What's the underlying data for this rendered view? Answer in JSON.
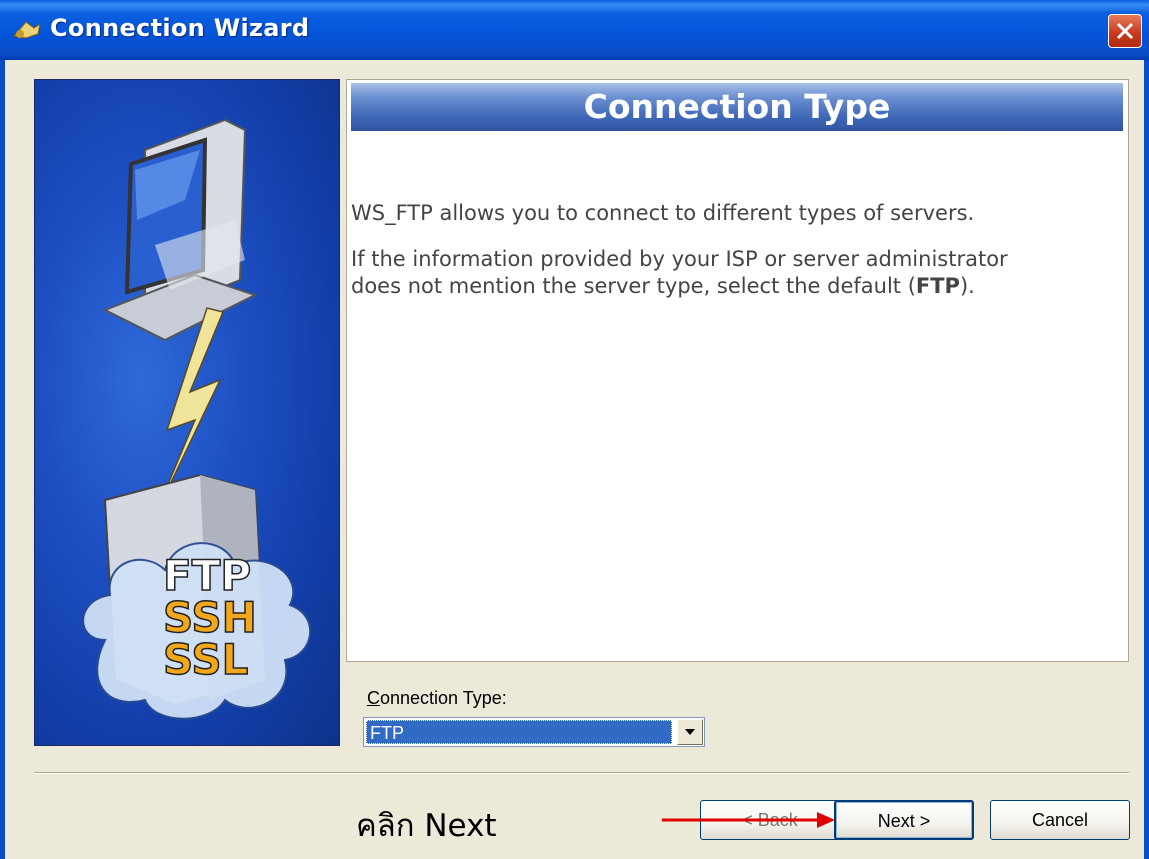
{
  "window": {
    "title": "Connection Wizard"
  },
  "art": {
    "labels": [
      "FTP",
      "SSH",
      "SSL"
    ]
  },
  "content": {
    "heading": "Connection Type",
    "para1": "WS_FTP allows you to connect to different types of servers.",
    "para2_line1": "If the information provided by your ISP or server administrator",
    "para2_line2_prefix": "does not mention the server type, select the default (",
    "para2_line2_bold": "FTP",
    "para2_line2_suffix": ")."
  },
  "connection_type": {
    "label_mnemonic": "C",
    "label_rest": "onnection Type:",
    "selected": "FTP"
  },
  "buttons": {
    "back": "< Back",
    "next": "Next >",
    "cancel": "Cancel"
  },
  "annotation": "คลิก Next",
  "colors": {
    "titlebar": "#0453d8",
    "close": "#c8371c",
    "arrow": "#e00000",
    "selection": "#316ac5"
  }
}
